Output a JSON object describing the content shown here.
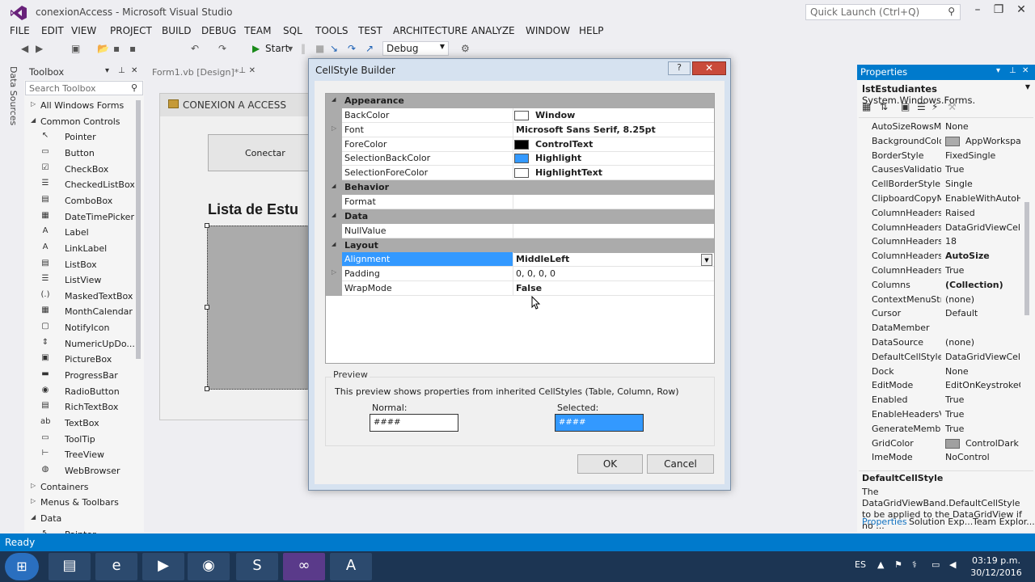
{
  "window": {
    "title": "conexionAccess - Microsoft Visual Studio",
    "quick_launch": "Quick Launch (Ctrl+Q)"
  },
  "menu": [
    "FILE",
    "EDIT",
    "VIEW",
    "PROJECT",
    "BUILD",
    "DEBUG",
    "TEAM",
    "SQL",
    "TOOLS",
    "TEST",
    "ARCHITECTURE",
    "ANALYZE",
    "WINDOW",
    "HELP"
  ],
  "toolbar": {
    "start_label": "Start",
    "configuration": "Debug"
  },
  "left_strip": {
    "label": "Data Sources"
  },
  "toolbox": {
    "title": "Toolbox",
    "search_placeholder": "Search Toolbox",
    "items": [
      {
        "label": "All Windows Forms",
        "group": true,
        "arrow": "▷"
      },
      {
        "label": "Common Controls",
        "group": true,
        "arrow": "◢"
      },
      {
        "label": "Pointer",
        "icon": "↖"
      },
      {
        "label": "Button",
        "icon": "▭"
      },
      {
        "label": "CheckBox",
        "icon": "☑"
      },
      {
        "label": "CheckedListBox",
        "icon": "☰"
      },
      {
        "label": "ComboBox",
        "icon": "▤"
      },
      {
        "label": "DateTimePicker",
        "icon": "▦"
      },
      {
        "label": "Label",
        "icon": "A"
      },
      {
        "label": "LinkLabel",
        "icon": "A"
      },
      {
        "label": "ListBox",
        "icon": "▤"
      },
      {
        "label": "ListView",
        "icon": "☰"
      },
      {
        "label": "MaskedTextBox",
        "icon": "(.)"
      },
      {
        "label": "MonthCalendar",
        "icon": "▦"
      },
      {
        "label": "NotifyIcon",
        "icon": "▢"
      },
      {
        "label": "NumericUpDo...",
        "icon": "⇕"
      },
      {
        "label": "PictureBox",
        "icon": "▣"
      },
      {
        "label": "ProgressBar",
        "icon": "▬"
      },
      {
        "label": "RadioButton",
        "icon": "◉"
      },
      {
        "label": "RichTextBox",
        "icon": "▤"
      },
      {
        "label": "TextBox",
        "icon": "ab"
      },
      {
        "label": "ToolTip",
        "icon": "▭"
      },
      {
        "label": "TreeView",
        "icon": "⊢"
      },
      {
        "label": "WebBrowser",
        "icon": "◍"
      },
      {
        "label": "Containers",
        "group": true,
        "arrow": "▷"
      },
      {
        "label": "Menus & Toolbars",
        "group": true,
        "arrow": "▷"
      },
      {
        "label": "Data",
        "group": true,
        "arrow": "◢"
      },
      {
        "label": "Pointer",
        "icon": "↖"
      }
    ]
  },
  "doc_tab": {
    "label": "Form1.vb [Design]*"
  },
  "form": {
    "title": "CONEXION A ACCESS",
    "button": "Conectar",
    "heading": "Lista de Estu"
  },
  "properties": {
    "title": "Properties",
    "object_name": "lstEstudiantes",
    "object_type": "System.Windows.Forms.",
    "rows": [
      {
        "name": "AutoSizeRowsMo",
        "value": "None"
      },
      {
        "name": "BackgroundColor",
        "value": "AppWorkspace",
        "swatch": "#ababab"
      },
      {
        "name": "BorderStyle",
        "value": "FixedSingle"
      },
      {
        "name": "CausesValidation",
        "value": "True"
      },
      {
        "name": "CellBorderStyle",
        "value": "Single"
      },
      {
        "name": "ClipboardCopyM",
        "value": "EnableWithAutoH"
      },
      {
        "name": "ColumnHeadersB",
        "value": "Raised"
      },
      {
        "name": "ColumnHeadersD",
        "value": "DataGridViewCellS"
      },
      {
        "name": "ColumnHeadersH",
        "value": "18"
      },
      {
        "name": "ColumnHeadersH",
        "value": "AutoSize",
        "bold": true
      },
      {
        "name": "ColumnHeadersV",
        "value": "True"
      },
      {
        "name": "Columns",
        "value": "(Collection)",
        "bold": true
      },
      {
        "name": "ContextMenuStrip",
        "value": "(none)"
      },
      {
        "name": "Cursor",
        "value": "Default"
      },
      {
        "name": "DataMember",
        "value": ""
      },
      {
        "name": "DataSource",
        "value": "(none)"
      },
      {
        "name": "DefaultCellStyle",
        "value": "DataGridViewCellS"
      },
      {
        "name": "Dock",
        "value": "None"
      },
      {
        "name": "EditMode",
        "value": "EditOnKeystrokeO"
      },
      {
        "name": "Enabled",
        "value": "True"
      },
      {
        "name": "EnableHeadersVis",
        "value": "True"
      },
      {
        "name": "GenerateMember",
        "value": "True"
      },
      {
        "name": "GridColor",
        "value": "ControlDark",
        "swatch": "#a0a0a0"
      },
      {
        "name": "ImeMode",
        "value": "NoControl"
      }
    ],
    "desc_title": "DefaultCellStyle",
    "desc_text": "The DataGridViewBand.DefaultCellStyle to be applied to the DataGridView if no ...",
    "tabs": [
      "Properties",
      "Solution Exp...",
      "Team Explor..."
    ]
  },
  "dialog": {
    "title": "CellStyle Builder",
    "help": "?",
    "close": "✕",
    "rows": [
      {
        "type": "category",
        "name": "Appearance"
      },
      {
        "name": "BackColor",
        "value": "Window",
        "swatch": "#ffffff"
      },
      {
        "name": "Font",
        "value": "Microsoft Sans Serif, 8.25pt",
        "expander": true
      },
      {
        "name": "ForeColor",
        "value": "ControlText",
        "swatch": "#000000"
      },
      {
        "name": "SelectionBackColor",
        "value": "Highlight",
        "swatch": "#3399ff"
      },
      {
        "name": "SelectionForeColor",
        "value": "HighlightText",
        "swatch": "#ffffff"
      },
      {
        "type": "category",
        "name": "Behavior"
      },
      {
        "name": "Format",
        "value": ""
      },
      {
        "type": "category",
        "name": "Data"
      },
      {
        "name": "NullValue",
        "value": ""
      },
      {
        "type": "category",
        "name": "Layout"
      },
      {
        "name": "Alignment",
        "value": "MiddleLeft",
        "selected": true
      },
      {
        "name": "Padding",
        "value": "0, 0, 0, 0",
        "expander": true,
        "normal": true
      },
      {
        "name": "WrapMode",
        "value": "False"
      }
    ],
    "preview_label": "Preview",
    "preview_text": "This preview shows properties from inherited CellStyles (Table, Column, Row)",
    "normal_label": "Normal:",
    "selected_label": "Selected:",
    "sample": "####",
    "ok": "OK",
    "cancel": "Cancel"
  },
  "status": {
    "text": "Ready"
  },
  "taskbar": {
    "lang": "ES",
    "time": "03:19 p.m.",
    "date": "30/12/2016"
  },
  "colors": {
    "accent": "#007acc",
    "highlight": "#3399ff",
    "taskbar": "#1c3553"
  }
}
